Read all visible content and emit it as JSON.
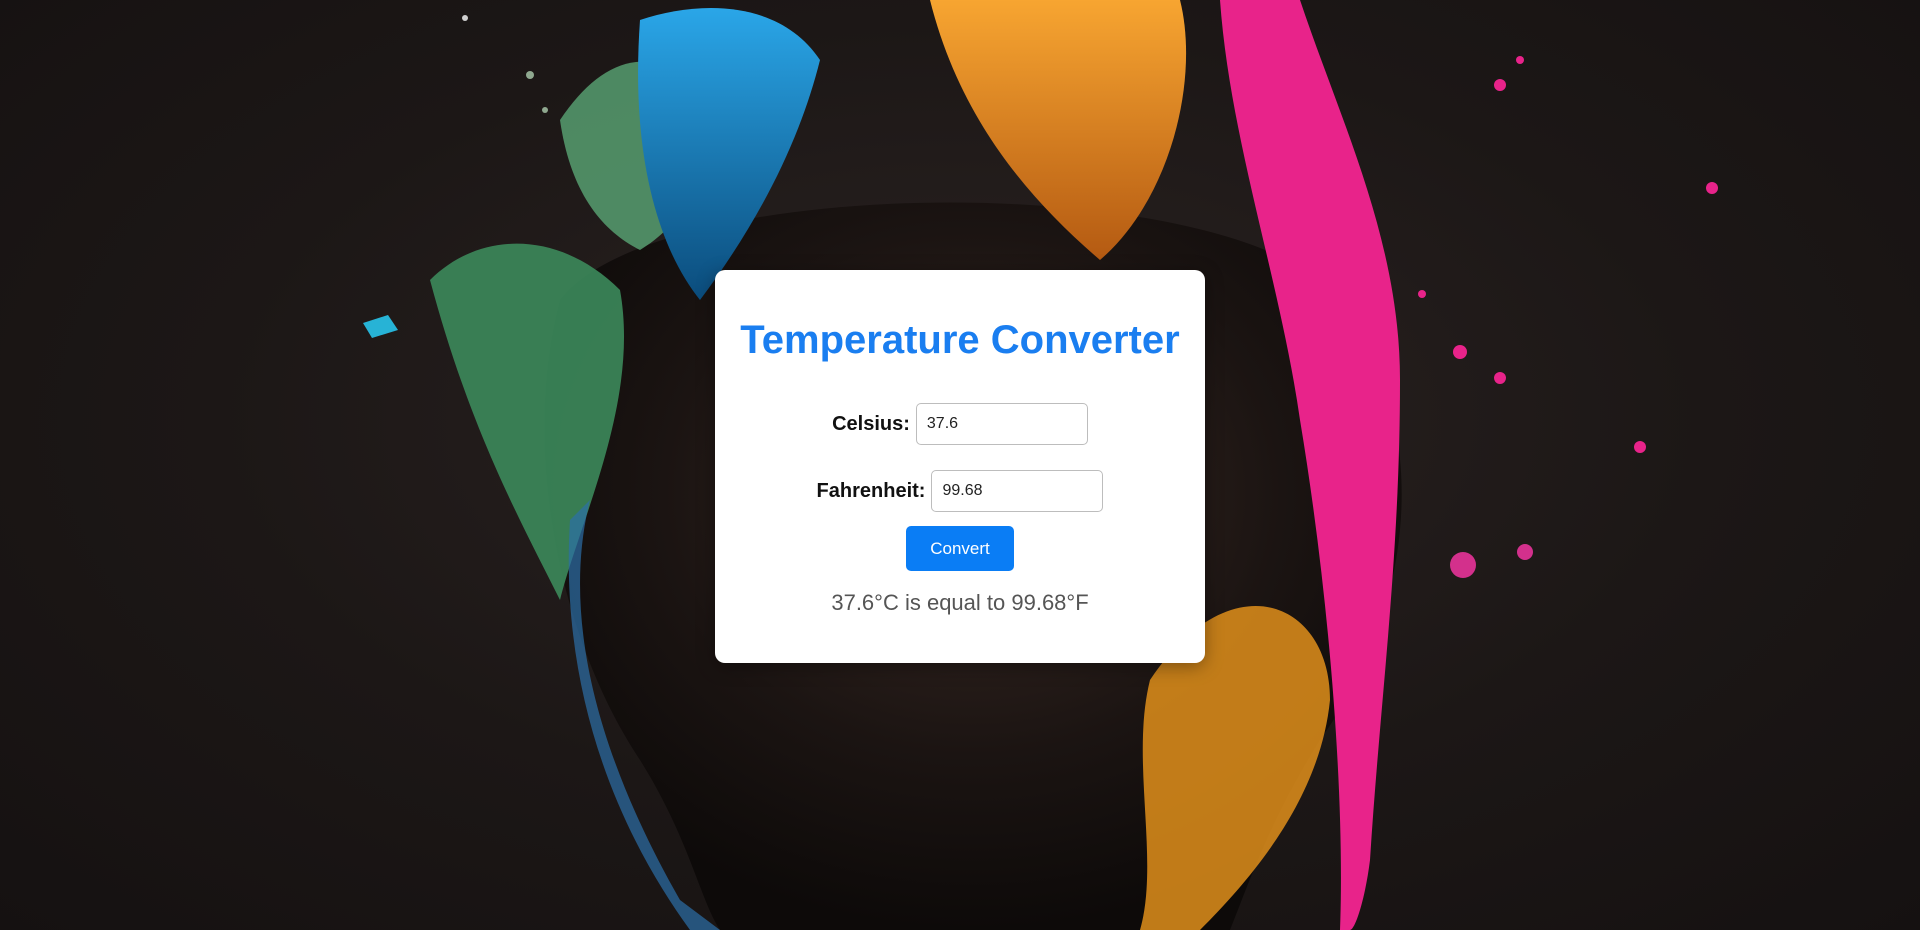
{
  "converter": {
    "title": "Temperature Converter",
    "celsius_label": "Celsius:",
    "celsius_value": "37.6",
    "fahrenheit_label": "Fahrenheit:",
    "fahrenheit_value": "99.68",
    "convert_label": "Convert",
    "result_text": "37.6°C is equal to 99.68°F"
  },
  "colors": {
    "accent": "#1a7ef0",
    "button": "#0a7df5",
    "card": "#ffffff"
  }
}
